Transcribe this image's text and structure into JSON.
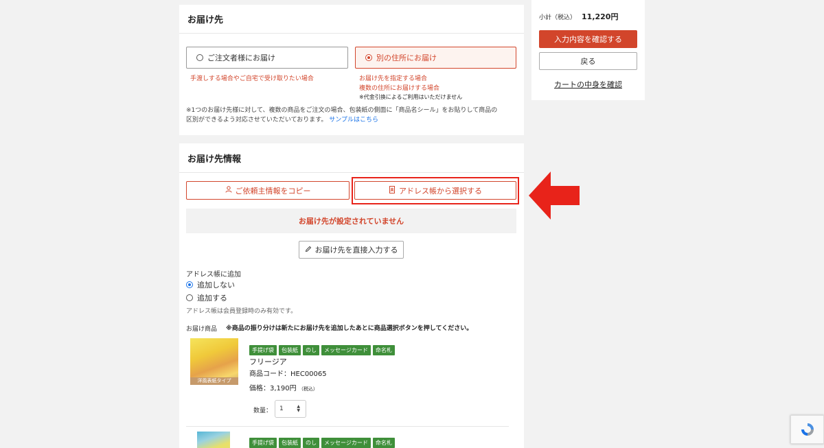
{
  "delivery": {
    "title": "お届け先",
    "option_self": "ご注文者様にお届け",
    "option_other": "別の住所にお届け",
    "note_self": "手渡しする場合やご自宅で受け取りたい場合",
    "note_other_1": "お届け先を指定する場合",
    "note_other_2": "複数の住所にお届けする場合",
    "note_other_3": "※代金引換によるご利用はいただけません",
    "info_line1": "※1つのお届け先様に対して、複数の商品をご注文の場合、包装紙の側面に「商品名シール」をお貼りして商品の",
    "info_line2": "区別ができるよう対応させていただいております。",
    "sample_link": "サンプルはこちら"
  },
  "delivery_info": {
    "title": "お届け先情報",
    "copy_button": "ご依頼主情報をコピー",
    "address_book_button": "アドレス帳から選択する",
    "status": "お届け先が設定されていません",
    "direct_input_button": "お届け先を直接入力する",
    "address_add_label": "アドレス帳に追加",
    "add_no": "追加しない",
    "add_yes": "追加する",
    "address_note": "アドレス帳は会員登録時のみ有効です。",
    "products_label": "お届け商品",
    "products_note": "※商品の振り分けは新たにお届け先を追加したあとに商品選択ボタンを押してください。"
  },
  "product": {
    "tags": [
      "手提げ袋",
      "包装紙",
      "のし",
      "メッセージカード",
      "命名札"
    ],
    "name": "フリージア",
    "code": "商品コード：HEC00065",
    "price": "価格：3,190円",
    "tax": "（税込）",
    "qty_label": "数量：",
    "qty_value": "1",
    "thumb_caption": "洋風表紙タイプ"
  },
  "product2": {
    "tags": [
      "手提げ袋",
      "包装紙",
      "のし",
      "メッセージカード",
      "命名札"
    ]
  },
  "summary": {
    "subtotal_label": "小計（税込）",
    "subtotal_value": "11,220円",
    "confirm_button": "入力内容を確認する",
    "back_button": "戻る",
    "cart_link": "カートの中身を確認"
  },
  "colors": {
    "accent": "#d2452b",
    "highlight_box": "#e8231a",
    "tag_green": "#3f8f3a",
    "link_blue": "#1a73e8"
  },
  "icons": [
    "radio-icon",
    "user-icon",
    "address-book-icon",
    "pencil-icon",
    "select-arrows-icon",
    "red-arrow-annotation",
    "recaptcha-icon"
  ]
}
